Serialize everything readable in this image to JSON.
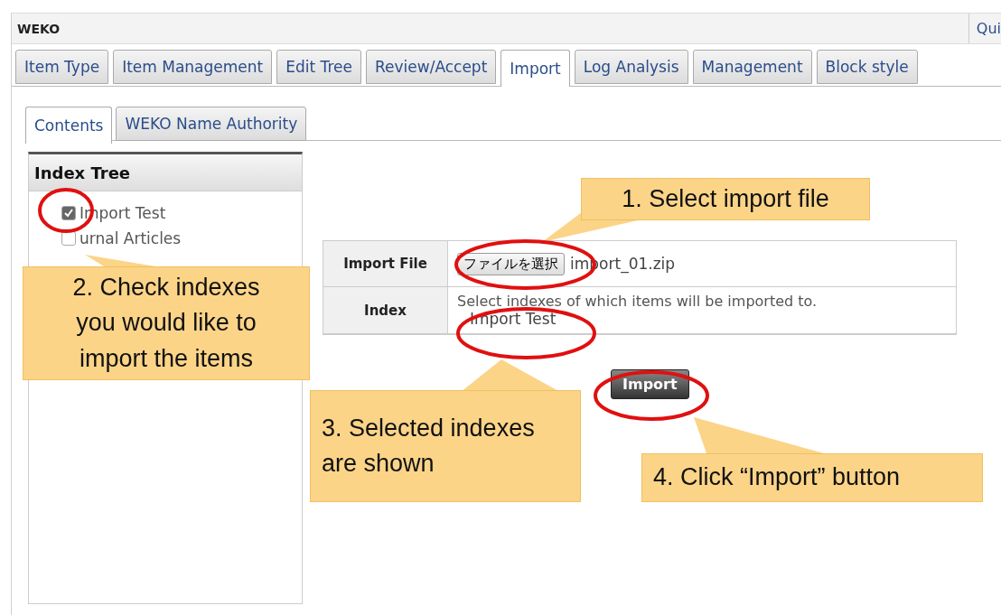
{
  "header": {
    "title": "WEKO",
    "quit": "Qui"
  },
  "tabs": [
    {
      "label": "Item Type",
      "selected": false
    },
    {
      "label": "Item Management",
      "selected": false
    },
    {
      "label": "Edit Tree",
      "selected": false
    },
    {
      "label": "Review/Accept",
      "selected": false
    },
    {
      "label": "Import",
      "selected": true
    },
    {
      "label": "Log Analysis",
      "selected": false
    },
    {
      "label": "Management",
      "selected": false
    },
    {
      "label": "Block style",
      "selected": false
    }
  ],
  "subtabs": [
    {
      "label": "Contents",
      "selected": true
    },
    {
      "label": "WEKO Name Authority",
      "selected": false
    }
  ],
  "index_tree": {
    "title": "Index Tree",
    "items": [
      {
        "label": "Import Test",
        "checked": true
      },
      {
        "label": "urnal Articles",
        "checked": false
      }
    ]
  },
  "form": {
    "rows": [
      {
        "kind": "file",
        "label": "Import File",
        "button": "ファイルを選択",
        "value": "import_01.zip"
      },
      {
        "kind": "index",
        "label": "Index",
        "hint": "Select indexes of which items will be imported to.",
        "value": "Import Test"
      }
    ],
    "submit": "Import"
  },
  "annotations": [
    "1. Select import file",
    "2. Check indexes you would like to import the items",
    "3. Selected indexes are shown",
    "4. Click “Import” button"
  ]
}
